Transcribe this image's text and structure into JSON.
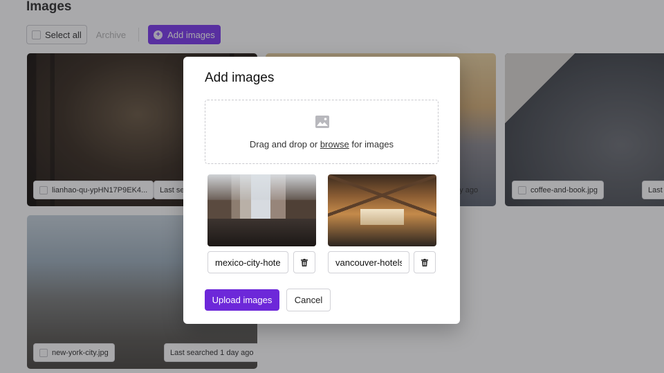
{
  "page": {
    "title": "Images",
    "toolbar": {
      "select_all": "Select all",
      "archive": "Archive",
      "add_images": "Add images"
    },
    "cards": [
      {
        "filename": "lianhao-qu-ypHN17P9EK4...",
        "status": "Last sea"
      },
      {
        "filename": "",
        "status": "day ago"
      },
      {
        "filename": "coffee-and-book.jpg",
        "status": "Last s"
      },
      {
        "filename": "new-york-city.jpg",
        "status": "Last searched 1 day ago"
      }
    ]
  },
  "modal": {
    "title": "Add images",
    "dropzone": {
      "text_before": "Drag and drop or ",
      "link": "browse",
      "text_after": " for images"
    },
    "files": [
      {
        "name": "mexico-city-hotels.jpg"
      },
      {
        "name": "vancouver-hotels.jpg"
      }
    ],
    "upload_label": "Upload images",
    "cancel_label": "Cancel"
  },
  "colors": {
    "accent": "#6d28d9",
    "overlay": "rgba(30,30,35,0.38)"
  },
  "icons": [
    "image-icon",
    "trash-icon",
    "plus-circle-icon",
    "checkbox-icon"
  ]
}
